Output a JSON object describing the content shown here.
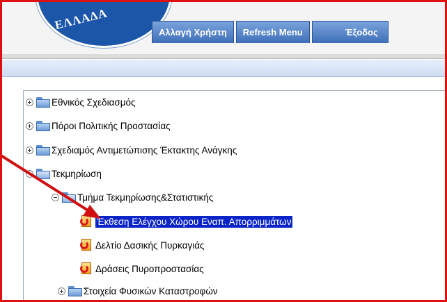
{
  "header": {
    "logo_text": "ΕΛΛΑΔΑ",
    "tabs": [
      {
        "label": "Αλλαγή Χρήστη"
      },
      {
        "label": "Refresh Menu"
      },
      {
        "label": "Έξοδος"
      }
    ]
  },
  "tree": {
    "items": [
      {
        "label": "Εθνικός Σχεδιασμός"
      },
      {
        "label": "Πόροι Πολιτικής Προστασίας"
      },
      {
        "label": "Σχεδιαμός Αντιμετώπισης Έκτακτης Ανάγκης"
      },
      {
        "label": "Τεκμηρίωση"
      },
      {
        "label": "Τμήμα Τεκμηρίωσης&Στατιστικής"
      },
      {
        "label": "Έκθεση Ελέγχου Χώρου Εναπ. Απορριμμάτων"
      },
      {
        "label": "Δελτίο Δασικής Πυρκαγιάς"
      },
      {
        "label": "Δράσεις Πυροπροστασίας"
      },
      {
        "label": "Στοιχεία Φυσικών  Καταστροφών"
      }
    ]
  },
  "colors": {
    "frame_border": "#e01010",
    "selection": "#0a24c8",
    "tab": "#3d6fb8",
    "annotation_arrow": "#d01010"
  }
}
